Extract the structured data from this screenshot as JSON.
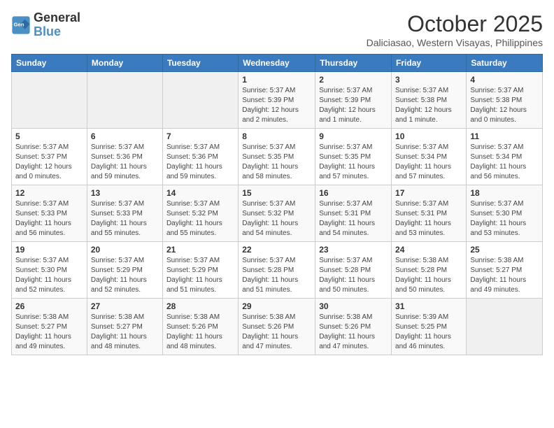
{
  "logo": {
    "line1": "General",
    "line2": "Blue"
  },
  "title": "October 2025",
  "location": "Daliciasao, Western Visayas, Philippines",
  "weekdays": [
    "Sunday",
    "Monday",
    "Tuesday",
    "Wednesday",
    "Thursday",
    "Friday",
    "Saturday"
  ],
  "weeks": [
    [
      {
        "day": "",
        "detail": ""
      },
      {
        "day": "",
        "detail": ""
      },
      {
        "day": "",
        "detail": ""
      },
      {
        "day": "1",
        "detail": "Sunrise: 5:37 AM\nSunset: 5:39 PM\nDaylight: 12 hours\nand 2 minutes."
      },
      {
        "day": "2",
        "detail": "Sunrise: 5:37 AM\nSunset: 5:39 PM\nDaylight: 12 hours\nand 1 minute."
      },
      {
        "day": "3",
        "detail": "Sunrise: 5:37 AM\nSunset: 5:38 PM\nDaylight: 12 hours\nand 1 minute."
      },
      {
        "day": "4",
        "detail": "Sunrise: 5:37 AM\nSunset: 5:38 PM\nDaylight: 12 hours\nand 0 minutes."
      }
    ],
    [
      {
        "day": "5",
        "detail": "Sunrise: 5:37 AM\nSunset: 5:37 PM\nDaylight: 12 hours\nand 0 minutes."
      },
      {
        "day": "6",
        "detail": "Sunrise: 5:37 AM\nSunset: 5:36 PM\nDaylight: 11 hours\nand 59 minutes."
      },
      {
        "day": "7",
        "detail": "Sunrise: 5:37 AM\nSunset: 5:36 PM\nDaylight: 11 hours\nand 59 minutes."
      },
      {
        "day": "8",
        "detail": "Sunrise: 5:37 AM\nSunset: 5:35 PM\nDaylight: 11 hours\nand 58 minutes."
      },
      {
        "day": "9",
        "detail": "Sunrise: 5:37 AM\nSunset: 5:35 PM\nDaylight: 11 hours\nand 57 minutes."
      },
      {
        "day": "10",
        "detail": "Sunrise: 5:37 AM\nSunset: 5:34 PM\nDaylight: 11 hours\nand 57 minutes."
      },
      {
        "day": "11",
        "detail": "Sunrise: 5:37 AM\nSunset: 5:34 PM\nDaylight: 11 hours\nand 56 minutes."
      }
    ],
    [
      {
        "day": "12",
        "detail": "Sunrise: 5:37 AM\nSunset: 5:33 PM\nDaylight: 11 hours\nand 56 minutes."
      },
      {
        "day": "13",
        "detail": "Sunrise: 5:37 AM\nSunset: 5:33 PM\nDaylight: 11 hours\nand 55 minutes."
      },
      {
        "day": "14",
        "detail": "Sunrise: 5:37 AM\nSunset: 5:32 PM\nDaylight: 11 hours\nand 55 minutes."
      },
      {
        "day": "15",
        "detail": "Sunrise: 5:37 AM\nSunset: 5:32 PM\nDaylight: 11 hours\nand 54 minutes."
      },
      {
        "day": "16",
        "detail": "Sunrise: 5:37 AM\nSunset: 5:31 PM\nDaylight: 11 hours\nand 54 minutes."
      },
      {
        "day": "17",
        "detail": "Sunrise: 5:37 AM\nSunset: 5:31 PM\nDaylight: 11 hours\nand 53 minutes."
      },
      {
        "day": "18",
        "detail": "Sunrise: 5:37 AM\nSunset: 5:30 PM\nDaylight: 11 hours\nand 53 minutes."
      }
    ],
    [
      {
        "day": "19",
        "detail": "Sunrise: 5:37 AM\nSunset: 5:30 PM\nDaylight: 11 hours\nand 52 minutes."
      },
      {
        "day": "20",
        "detail": "Sunrise: 5:37 AM\nSunset: 5:29 PM\nDaylight: 11 hours\nand 52 minutes."
      },
      {
        "day": "21",
        "detail": "Sunrise: 5:37 AM\nSunset: 5:29 PM\nDaylight: 11 hours\nand 51 minutes."
      },
      {
        "day": "22",
        "detail": "Sunrise: 5:37 AM\nSunset: 5:28 PM\nDaylight: 11 hours\nand 51 minutes."
      },
      {
        "day": "23",
        "detail": "Sunrise: 5:37 AM\nSunset: 5:28 PM\nDaylight: 11 hours\nand 50 minutes."
      },
      {
        "day": "24",
        "detail": "Sunrise: 5:38 AM\nSunset: 5:28 PM\nDaylight: 11 hours\nand 50 minutes."
      },
      {
        "day": "25",
        "detail": "Sunrise: 5:38 AM\nSunset: 5:27 PM\nDaylight: 11 hours\nand 49 minutes."
      }
    ],
    [
      {
        "day": "26",
        "detail": "Sunrise: 5:38 AM\nSunset: 5:27 PM\nDaylight: 11 hours\nand 49 minutes."
      },
      {
        "day": "27",
        "detail": "Sunrise: 5:38 AM\nSunset: 5:27 PM\nDaylight: 11 hours\nand 48 minutes."
      },
      {
        "day": "28",
        "detail": "Sunrise: 5:38 AM\nSunset: 5:26 PM\nDaylight: 11 hours\nand 48 minutes."
      },
      {
        "day": "29",
        "detail": "Sunrise: 5:38 AM\nSunset: 5:26 PM\nDaylight: 11 hours\nand 47 minutes."
      },
      {
        "day": "30",
        "detail": "Sunrise: 5:38 AM\nSunset: 5:26 PM\nDaylight: 11 hours\nand 47 minutes."
      },
      {
        "day": "31",
        "detail": "Sunrise: 5:39 AM\nSunset: 5:25 PM\nDaylight: 11 hours\nand 46 minutes."
      },
      {
        "day": "",
        "detail": ""
      }
    ]
  ]
}
